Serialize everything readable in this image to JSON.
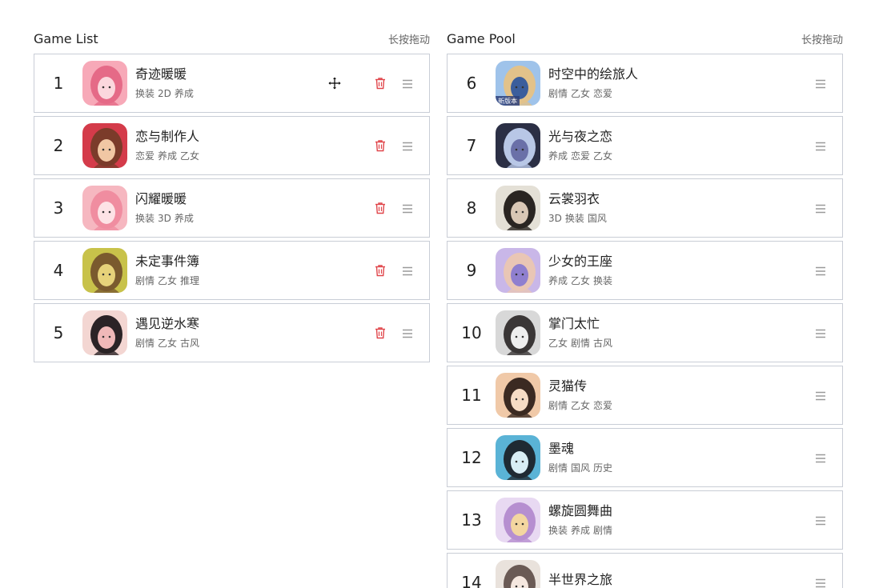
{
  "game_list": {
    "title": "Game List",
    "hint": "长按拖动",
    "items": [
      {
        "num": "1",
        "name": "奇迹暖暖",
        "tags": [
          "换装",
          "2D",
          "养成"
        ],
        "colors": [
          "#f7a9b8",
          "#e56a87",
          "#fbd7dd"
        ]
      },
      {
        "num": "2",
        "name": "恋与制作人",
        "tags": [
          "恋爱",
          "养成",
          "乙女"
        ],
        "colors": [
          "#d43b4a",
          "#7b3b2a",
          "#f1c7a4"
        ]
      },
      {
        "num": "3",
        "name": "闪耀暖暖",
        "tags": [
          "换装",
          "3D",
          "养成"
        ],
        "colors": [
          "#f6b7c0",
          "#f08da0",
          "#fde3e6"
        ]
      },
      {
        "num": "4",
        "name": "未定事件簿",
        "tags": [
          "剧情",
          "乙女",
          "推理"
        ],
        "colors": [
          "#c8c24a",
          "#7a5a2e",
          "#e6d27a"
        ]
      },
      {
        "num": "5",
        "name": "遇见逆水寒",
        "tags": [
          "剧情",
          "乙女",
          "古风"
        ],
        "colors": [
          "#f3d6d2",
          "#2b2326",
          "#f0b8b8"
        ]
      }
    ]
  },
  "game_pool": {
    "title": "Game Pool",
    "hint": "长按拖动",
    "items": [
      {
        "num": "6",
        "name": "时空中的绘旅人",
        "tags": [
          "剧情",
          "乙女",
          "恋爱"
        ],
        "colors": [
          "#9fc3ea",
          "#e2c28a",
          "#3b5e9c"
        ],
        "badge": "新版本"
      },
      {
        "num": "7",
        "name": "光与夜之恋",
        "tags": [
          "养成",
          "恋爱",
          "乙女"
        ],
        "colors": [
          "#2b2f45",
          "#b8c7e6",
          "#6a70a8"
        ]
      },
      {
        "num": "8",
        "name": "云裳羽衣",
        "tags": [
          "3D",
          "换装",
          "国风"
        ],
        "colors": [
          "#e4e0d6",
          "#2a2522",
          "#d9c7b5"
        ]
      },
      {
        "num": "9",
        "name": "少女的王座",
        "tags": [
          "养成",
          "乙女",
          "换装"
        ],
        "colors": [
          "#c9b7e8",
          "#e9c6b5",
          "#8f7fcf"
        ]
      },
      {
        "num": "10",
        "name": "掌门太忙",
        "tags": [
          "乙女",
          "剧情",
          "古风"
        ],
        "colors": [
          "#d8d8d8",
          "#3a3636",
          "#eeeeee"
        ]
      },
      {
        "num": "11",
        "name": "灵猫传",
        "tags": [
          "剧情",
          "乙女",
          "恋爱"
        ],
        "colors": [
          "#f0c9a8",
          "#3b2a22",
          "#f6dcc5"
        ]
      },
      {
        "num": "12",
        "name": "墨魂",
        "tags": [
          "剧情",
          "国风",
          "历史"
        ],
        "colors": [
          "#5ab3d6",
          "#1f2a33",
          "#d8eef5"
        ]
      },
      {
        "num": "13",
        "name": "螺旋圆舞曲",
        "tags": [
          "换装",
          "养成",
          "剧情"
        ],
        "colors": [
          "#e8d9f2",
          "#b68fd0",
          "#f3d6a0"
        ]
      },
      {
        "num": "14",
        "name": "半世界之旅",
        "tags": [],
        "colors": [
          "#e9e2dc",
          "#6a5a55",
          "#f5e7df"
        ]
      }
    ]
  }
}
